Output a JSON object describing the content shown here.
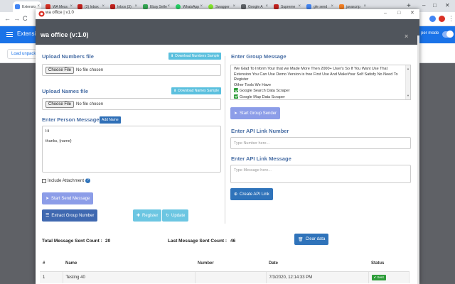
{
  "browser": {
    "tabs": [
      {
        "label": "Extensio",
        "color": "#4285f4",
        "active": true
      },
      {
        "label": "WA Mess",
        "color": "#d93025"
      },
      {
        "label": "(3) Inbox",
        "color": "#c5221f"
      },
      {
        "label": "Inbox (3)",
        "color": "#c5221f"
      },
      {
        "label": "Ebay Selle",
        "color": "#34a853"
      },
      {
        "label": "WhatsApp",
        "color": "#25d366"
      },
      {
        "label": "Swagger",
        "color": "#85ea2d"
      },
      {
        "label": "Google A",
        "color": "#5f6368"
      },
      {
        "label": "Supreme",
        "color": "#c5221f"
      },
      {
        "label": "gfe send",
        "color": "#4285f4"
      },
      {
        "label": "javascrip",
        "color": "#f48024"
      }
    ],
    "new_tab": "+",
    "window_controls": [
      "–",
      "□",
      "✕"
    ],
    "back": "←",
    "forward": "→",
    "reload": "C",
    "page_title": "Extension",
    "dev_mode_label": "per mode",
    "load_unpacked": "Load unpacke"
  },
  "window": {
    "title": "wa office | v1.0",
    "controls": [
      "–",
      "□",
      "✕"
    ],
    "heading": "wa office (v:1.0)",
    "close": "×"
  },
  "left": {
    "upload_numbers_label": "Upload Numbers file",
    "download_numbers_sample": "Download Numbers Sample",
    "upload_names_label": "Upload Names file",
    "download_names_sample": "Download Names Sample",
    "choose_file": "Choose File",
    "no_file": "No file chosen",
    "enter_message_label": "Enter Person Message",
    "add_name": "Add Name",
    "message_lines": [
      "Hi",
      "thanks, {name}"
    ],
    "include_attachment": "Include Attachment",
    "help_icon": "?",
    "start_send": "Start Send Message",
    "extract_group": "Extract Group Number",
    "register": "Register",
    "update": "Update"
  },
  "right": {
    "enter_group_label": "Enter Group Message",
    "group_message_lines": [
      "We Glad To Inform Your that  we Made More Then 2000+ User's So If You Want Use That Extension You Can Use Demo Version is free First Use And MakeYour Self Satisfy No Need To Register",
      "Other Tools We Have"
    ],
    "tools": [
      "Google Search Data Scraper",
      "Google Map Data Scraper"
    ],
    "start_group_sender": "Start Group Sender",
    "api_number_label": "Enter API Link Number",
    "api_number_placeholder": "Type Number here...",
    "api_message_label": "Enter API Link Message",
    "api_message_placeholder": "Type Message here...",
    "create_api_link": "Create API Link"
  },
  "stats": {
    "total_label": "Total Message Sent Count :",
    "total_value": "20",
    "last_label": "Last Message Sent Count :",
    "last_value": "46",
    "clear_data": "Clear data"
  },
  "table": {
    "headers": [
      "#",
      "Name",
      "Number",
      "Date",
      "Status"
    ],
    "rows": [
      {
        "index": "1",
        "name": "Testing 40",
        "number": "",
        "date": "7/3/2020, 12:14:33 PM",
        "status": "Sent"
      }
    ]
  },
  "colors": {
    "accent_blue": "#1a73e8",
    "label_blue": "#4a6fa5",
    "sent_green": "#2e9d3a",
    "header_dark": "#50555c"
  }
}
